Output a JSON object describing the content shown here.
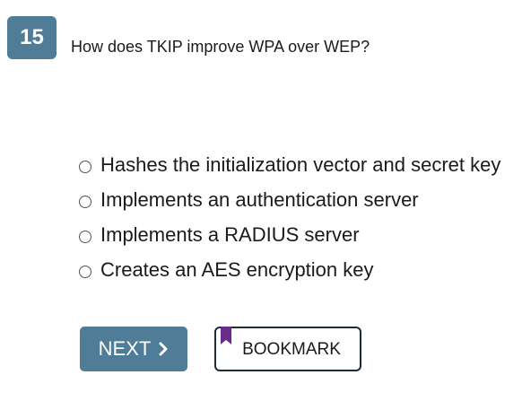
{
  "question": {
    "number": "15",
    "text": "How does TKIP improve WPA over WEP?",
    "options": [
      "Hashes the initialization vector and secret key",
      "Implements an authentication server",
      "Implements a RADIUS server",
      "Creates an AES encryption key"
    ]
  },
  "actions": {
    "next_label": "NEXT",
    "bookmark_label": "BOOKMARK"
  },
  "colors": {
    "accent": "#4f7c96",
    "bookmark_border": "#1e2a36",
    "bookmark_ribbon": "#6a2c8c"
  },
  "icons": {
    "next": "chevron-right-icon",
    "bookmark": "bookmark-ribbon-icon"
  }
}
